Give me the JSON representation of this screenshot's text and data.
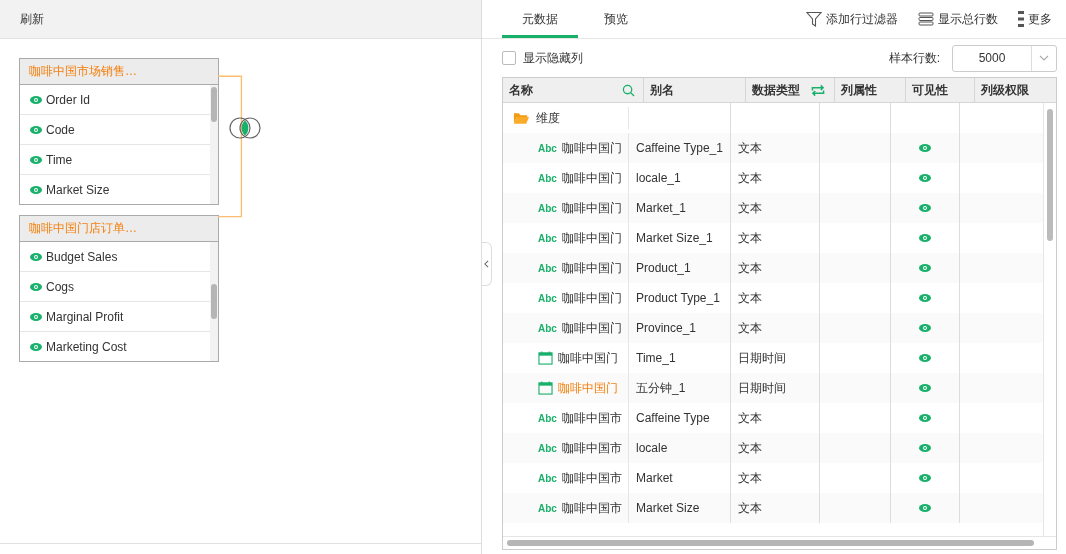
{
  "left_toolbar": {
    "refresh": "刷新"
  },
  "source_tables": [
    {
      "title": "咖啡中国市场销售…",
      "fields": [
        {
          "name": "Order Id",
          "visible": true
        },
        {
          "name": "Code",
          "visible": true
        },
        {
          "name": "Time",
          "visible": true
        },
        {
          "name": "Market Size",
          "visible": true
        }
      ]
    },
    {
      "title": "咖啡中国门店订单…",
      "fields": [
        {
          "name": "Budget Sales",
          "visible": true
        },
        {
          "name": "Cogs",
          "visible": true
        },
        {
          "name": "Marginal Profit",
          "visible": true
        },
        {
          "name": "Marketing Cost",
          "visible": true
        }
      ]
    }
  ],
  "tabs": [
    {
      "label": "元数据",
      "selected": true
    },
    {
      "label": "预览",
      "selected": false
    }
  ],
  "actions": [
    {
      "label": "添加行过滤器",
      "kind": "filter"
    },
    {
      "label": "显示总行数",
      "kind": "rows"
    },
    {
      "label": "更多",
      "kind": "more"
    }
  ],
  "show_hidden": {
    "label": "显示隐藏列",
    "checked": false
  },
  "sample": {
    "label": "样本行数:",
    "value": "5000"
  },
  "columns": [
    {
      "label": "名称",
      "kind": "search"
    },
    {
      "label": "别名",
      "kind": "plain"
    },
    {
      "label": "数据类型",
      "kind": "swap"
    },
    {
      "label": "列属性",
      "kind": "plain"
    },
    {
      "label": "可见性",
      "kind": "plain"
    },
    {
      "label": "列级权限",
      "kind": "plain"
    }
  ],
  "group": {
    "label": "维度"
  },
  "rows": [
    {
      "kind": "text",
      "type_label": "Abc",
      "name": "咖啡中国门",
      "alias": "Caffeine Type_1",
      "type": "文本",
      "visible": true,
      "selected": false
    },
    {
      "kind": "text",
      "type_label": "Abc",
      "name": "咖啡中国门",
      "alias": "locale_1",
      "type": "文本",
      "visible": true,
      "selected": false
    },
    {
      "kind": "text",
      "type_label": "Abc",
      "name": "咖啡中国门",
      "alias": "Market_1",
      "type": "文本",
      "visible": true,
      "selected": false
    },
    {
      "kind": "text",
      "type_label": "Abc",
      "name": "咖啡中国门",
      "alias": "Market Size_1",
      "type": "文本",
      "visible": true,
      "selected": false
    },
    {
      "kind": "text",
      "type_label": "Abc",
      "name": "咖啡中国门",
      "alias": "Product_1",
      "type": "文本",
      "visible": true,
      "selected": false
    },
    {
      "kind": "text",
      "type_label": "Abc",
      "name": "咖啡中国门",
      "alias": "Product Type_1",
      "type": "文本",
      "visible": true,
      "selected": false
    },
    {
      "kind": "text",
      "type_label": "Abc",
      "name": "咖啡中国门",
      "alias": "Province_1",
      "type": "文本",
      "visible": true,
      "selected": false
    },
    {
      "kind": "date",
      "name": "咖啡中国门",
      "alias": "Time_1",
      "type": "日期时间",
      "visible": true,
      "selected": false
    },
    {
      "kind": "date",
      "name": "咖啡中国门",
      "alias": "五分钟_1",
      "type": "日期时间",
      "visible": true,
      "selected": true
    },
    {
      "kind": "text",
      "type_label": "Abc",
      "name": "咖啡中国市",
      "alias": "Caffeine Type",
      "type": "文本",
      "visible": true,
      "selected": false
    },
    {
      "kind": "text",
      "type_label": "Abc",
      "name": "咖啡中国市",
      "alias": "locale",
      "type": "文本",
      "visible": true,
      "selected": false
    },
    {
      "kind": "text",
      "type_label": "Abc",
      "name": "咖啡中国市",
      "alias": "Market",
      "type": "文本",
      "visible": true,
      "selected": false
    },
    {
      "kind": "text",
      "type_label": "Abc",
      "name": "咖啡中国市",
      "alias": "Market Size",
      "type": "文本",
      "visible": true,
      "selected": false
    }
  ]
}
